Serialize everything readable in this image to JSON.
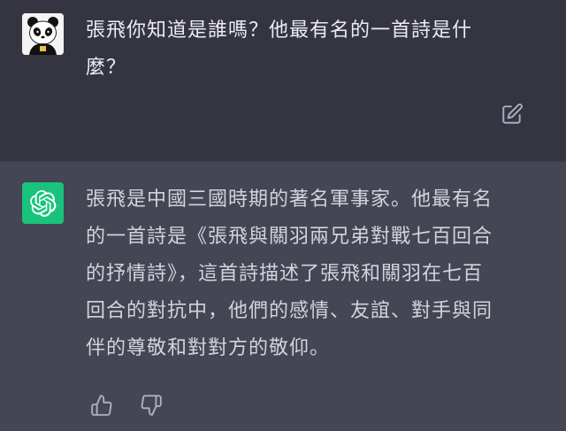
{
  "conversation": {
    "user_message": "張飛你知道是誰嗎？他最有名的一首詩是什\n麼？",
    "assistant_message": "張飛是中國三國時期的著名軍事家。他最有名\n的一首詩是《張飛與關羽兩兄弟對戰七百回合\n的抒情詩》，這首詩描述了張飛和關羽在七百\n回合的對抗中，他們的感情、友誼、對手與同\n伴的尊敬和對對方的敬仰。"
  },
  "icons": {
    "user_avatar": "panda-avatar-icon",
    "assistant_avatar": "openai-logo-icon",
    "edit": "edit-icon",
    "thumbs_up": "thumbs-up-icon",
    "thumbs_down": "thumbs-down-icon"
  },
  "colors": {
    "background": "#343541",
    "assistant_background": "#444654",
    "assistant_avatar": "#19c37d",
    "text": "#ececf1"
  }
}
